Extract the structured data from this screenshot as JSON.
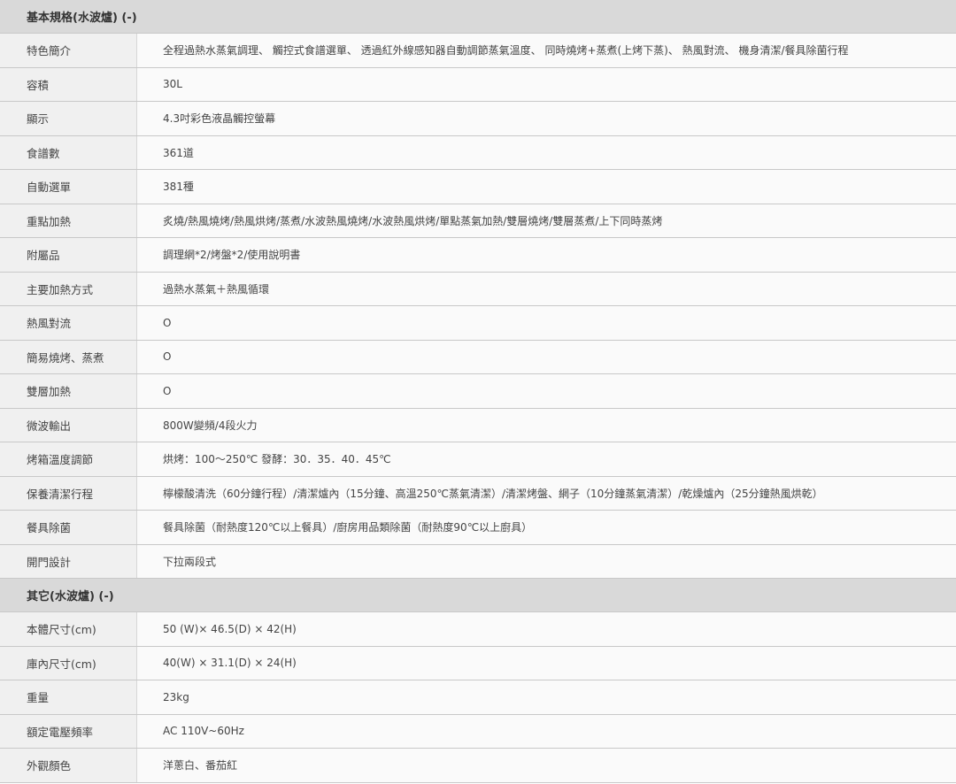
{
  "sections": [
    {
      "title": "基本規格(水波爐) (-)",
      "rows": [
        {
          "label": "特色簡介",
          "value": "全程過熱水蒸氣調理、 觸控式食譜選單、 透過紅外線感知器自動調節蒸氣溫度、 同時燒烤+蒸煮(上烤下蒸)、 熱風對流、 機身清潔/餐具除菌行程"
        },
        {
          "label": "容積",
          "value": "30L"
        },
        {
          "label": "顯示",
          "value": "4.3吋彩色液晶觸控螢幕"
        },
        {
          "label": "食譜數",
          "value": "361道"
        },
        {
          "label": "自動選單",
          "value": "381種"
        },
        {
          "label": "重點加熱",
          "value": "炙燒/熱風燒烤/熱風烘烤/蒸煮/水波熱風燒烤/水波熱風烘烤/單點蒸氣加熱/雙層燒烤/雙層蒸煮/上下同時蒸烤"
        },
        {
          "label": "附屬品",
          "value": "調理網*2/烤盤*2/使用說明書"
        },
        {
          "label": "主要加熱方式",
          "value": "過熱水蒸氣＋熱風循環"
        },
        {
          "label": "熱風對流",
          "value": "O"
        },
        {
          "label": "簡易燒烤、蒸煮",
          "value": "O"
        },
        {
          "label": "雙層加熱",
          "value": "O"
        },
        {
          "label": "微波輸出",
          "value": "800W變頻/4段火力"
        },
        {
          "label": "烤箱溫度調節",
          "value": "烘烤：100～250℃ 發酵：30．35．40．45℃"
        },
        {
          "label": "保養清潔行程",
          "value": "檸檬酸清洗（60分鐘行程）/清潔爐內（15分鐘、高溫250℃蒸氣清潔）/清潔烤盤、網子（10分鐘蒸氣清潔）/乾燥爐內（25分鐘熱風烘乾）"
        },
        {
          "label": "餐具除菌",
          "value": "餐具除菌（耐熱度120℃以上餐具）/廚房用品類除菌（耐熱度90℃以上廚具）"
        },
        {
          "label": "開門設計",
          "value": "下拉兩段式"
        }
      ]
    },
    {
      "title": "其它(水波爐) (-)",
      "rows": [
        {
          "label": "本體尺寸(cm)",
          "value": "50 (W)× 46.5(D) × 42(H)"
        },
        {
          "label": "庫內尺寸(cm)",
          "value": "40(W) × 31.1(D) × 24(H)"
        },
        {
          "label": "重量",
          "value": "23kg"
        },
        {
          "label": "額定電壓頻率",
          "value": "AC 110V~60Hz"
        },
        {
          "label": "外觀顏色",
          "value": "洋蔥白、番茄紅"
        }
      ]
    }
  ]
}
